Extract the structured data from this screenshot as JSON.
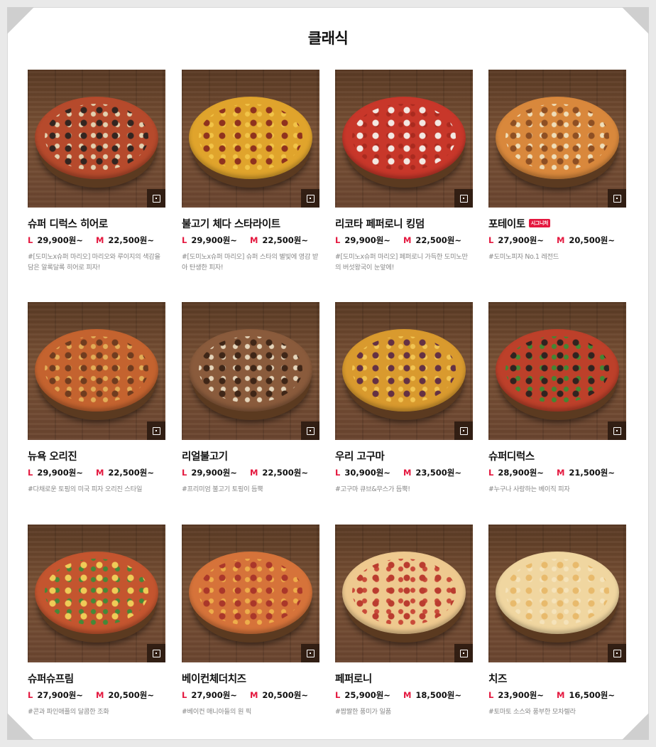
{
  "section_title": "클래식",
  "size_labels": {
    "large": "L",
    "medium": "M"
  },
  "menu": [
    {
      "name": "슈퍼 디럭스 히어로",
      "badge": "",
      "price_l": "29,900원~",
      "price_m": "22,500원~",
      "desc": "#[도미노x슈퍼 마리오] 마리오와 루이지의 색감을 담은 알록달록 히어로 피자!",
      "colors": {
        "crust": "#d99a55",
        "top": "#b64a2c",
        "dot1": "#2d2420",
        "dot2": "#e6d9b8"
      }
    },
    {
      "name": "불고기 체다 스타라이트",
      "badge": "",
      "price_l": "29,900원~",
      "price_m": "22,500원~",
      "desc": "#[도미노x슈퍼 마리오] 슈퍼 스타의 별빛에 영감 받아 탄생한 피자!",
      "colors": {
        "crust": "#dba05a",
        "top": "#e0a42c",
        "dot1": "#8b2c1e",
        "dot2": "#f3c64a"
      }
    },
    {
      "name": "리코타 페퍼로니 킹덤",
      "badge": "",
      "price_l": "29,900원~",
      "price_m": "22,500원~",
      "desc": "#[도미노x슈퍼 마리오] 페퍼로니 가득한 도미노만의 버섯왕국이 눈앞에!",
      "colors": {
        "crust": "#d9964f",
        "top": "#c8372a",
        "dot1": "#f6f2ec",
        "dot2": "#a82a1f"
      }
    },
    {
      "name": "포테이토",
      "badge": "시그니처",
      "price_l": "27,900원~",
      "price_m": "20,500원~",
      "desc": "#도미노피자 No.1 레전드",
      "colors": {
        "crust": "#dca35e",
        "top": "#d9883c",
        "dot1": "#8a4d22",
        "dot2": "#f1e3c0"
      }
    },
    {
      "name": "뉴욕 오리진",
      "badge": "",
      "price_l": "29,900원~",
      "price_m": "22,500원~",
      "desc": "#다채로운 토핑의 미국 피자 오리진 스타일",
      "colors": {
        "crust": "#d6984f",
        "top": "#c4632f",
        "dot1": "#6c3a1f",
        "dot2": "#e4b25a"
      }
    },
    {
      "name": "리얼불고기",
      "badge": "",
      "price_l": "29,900원~",
      "price_m": "22,500원~",
      "desc": "#프리미엄 불고기 토핑이 듬뿍",
      "colors": {
        "crust": "#d99e56",
        "top": "#8a5b3c",
        "dot1": "#3b2416",
        "dot2": "#eadcc2"
      }
    },
    {
      "name": "우리 고구마",
      "badge": "",
      "price_l": "30,900원~",
      "price_m": "23,500원~",
      "desc": "#고구마 큐브&무스가 듬뿍!",
      "colors": {
        "crust": "#d89e55",
        "top": "#d99a2e",
        "dot1": "#5e2c46",
        "dot2": "#f4c856"
      }
    },
    {
      "name": "슈퍼디럭스",
      "badge": "",
      "price_l": "28,900원~",
      "price_m": "21,500원~",
      "desc": "#누구나 사랑하는 베이직 피자",
      "colors": {
        "crust": "#d7954f",
        "top": "#bd402a",
        "dot1": "#2a2220",
        "dot2": "#3d8a34"
      }
    },
    {
      "name": "슈퍼슈프림",
      "badge": "",
      "price_l": "27,900원~",
      "price_m": "20,500원~",
      "desc": "#콘과 파인애플의 달콤한 조화",
      "colors": {
        "crust": "#d9984f",
        "top": "#c4552f",
        "dot1": "#f2d25a",
        "dot2": "#3f8c39"
      }
    },
    {
      "name": "베이컨체더치즈",
      "badge": "",
      "price_l": "27,900원~",
      "price_m": "20,500원~",
      "desc": "#베이컨 매니아들의 원 픽",
      "colors": {
        "crust": "#dc9f55",
        "top": "#d6733a",
        "dot1": "#a8342a",
        "dot2": "#f0b24c"
      }
    },
    {
      "name": "페퍼로니",
      "badge": "",
      "price_l": "25,900원~",
      "price_m": "18,500원~",
      "desc": "#짭짤한 풍미가 일품",
      "colors": {
        "crust": "#dca45e",
        "top": "#eec98f",
        "dot1": "#b8352a",
        "dot2": "#c84435"
      }
    },
    {
      "name": "치즈",
      "badge": "",
      "price_l": "23,900원~",
      "price_m": "16,500원~",
      "desc": "#토마토 소스와 풍부한 모차렐라",
      "colors": {
        "crust": "#d9a25e",
        "top": "#f0d6a0",
        "dot1": "#e8b96a",
        "dot2": "#f6e4bc"
      }
    }
  ]
}
